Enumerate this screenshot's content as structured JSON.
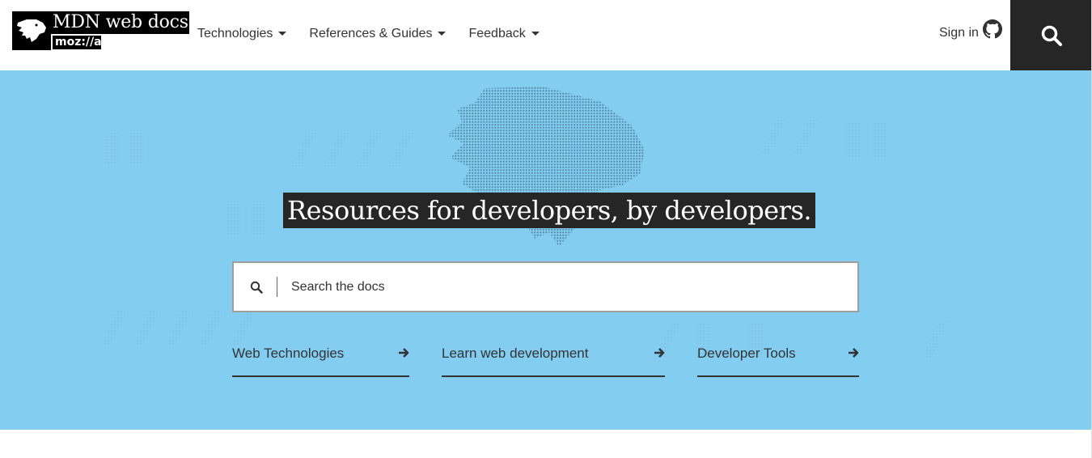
{
  "header": {
    "logo_main": "MDN web docs",
    "logo_sub": "moz://a",
    "nav": [
      {
        "label": "Technologies"
      },
      {
        "label": "References & Guides"
      },
      {
        "label": "Feedback"
      }
    ],
    "signin_label": "Sign in",
    "signin_icon": "github-icon",
    "search_icon": "search-icon"
  },
  "hero": {
    "tagline": "Resources for developers, by developers.",
    "search": {
      "placeholder": "Search the docs",
      "value": ""
    },
    "quick_links": [
      {
        "label": "Web Technologies"
      },
      {
        "label": "Learn web development"
      },
      {
        "label": "Developer Tools"
      }
    ],
    "background_color": "#83cdf1"
  },
  "colors": {
    "dark": "#262626",
    "text": "#333333"
  }
}
